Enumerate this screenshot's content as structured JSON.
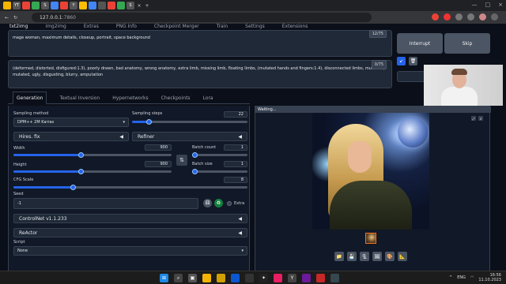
{
  "browser": {
    "url_host": "127.0.0.1",
    "url_port": ":7860"
  },
  "top_nav": [
    "txt2img",
    "img2img",
    "Extras",
    "PNG Info",
    "Checkpoint Merger",
    "Train",
    "Settings",
    "Extensions"
  ],
  "prompt": {
    "text": "mage woman, maximum details, closeup, portrait, space background",
    "token_count": "12/75"
  },
  "negative_prompt": {
    "text": "(deformed, distorted, disfigured:1.3), poorly drawn, bad anatomy, wrong anatomy, extra limb, missing limb, floating limbs, (mutated hands and fingers:1.4), disconnected limbs, mutation, mutated, ugly, disgusting, blurry, amputation",
    "token_count": "0/75"
  },
  "buttons": {
    "interrupt": "Interrupt",
    "skip": "Skip"
  },
  "settings_tabs": [
    "Generation",
    "Textual Inversion",
    "Hypernetworks",
    "Checkpoints",
    "Lora"
  ],
  "generation": {
    "sampling_method_label": "Sampling method",
    "sampling_method_value": "DPM++ 2M Karras",
    "sampling_steps_label": "Sampling steps",
    "sampling_steps_value": "22",
    "hires_fix": "Hires. fix",
    "refiner": "Refiner",
    "width_label": "Width",
    "width_value": "900",
    "height_label": "Height",
    "height_value": "900",
    "batch_count_label": "Batch count",
    "batch_count_value": "1",
    "batch_size_label": "Batch size",
    "batch_size_value": "1",
    "cfg_scale_label": "CFG Scale",
    "cfg_scale_value": "8",
    "seed_label": "Seed",
    "seed_value": "-1",
    "extra_label": "Extra",
    "controlnet": "ControlNet v1.1.233",
    "reactor": "ReActor",
    "script_label": "Script",
    "script_value": "None"
  },
  "output": {
    "status": "Waiting..."
  },
  "taskbar": {
    "language": "ENG",
    "time": "16:56",
    "date": "11.10.2023"
  },
  "colors": {
    "accent": "#2563eb",
    "background": "#0b0f19",
    "panel": "#1f2937"
  }
}
